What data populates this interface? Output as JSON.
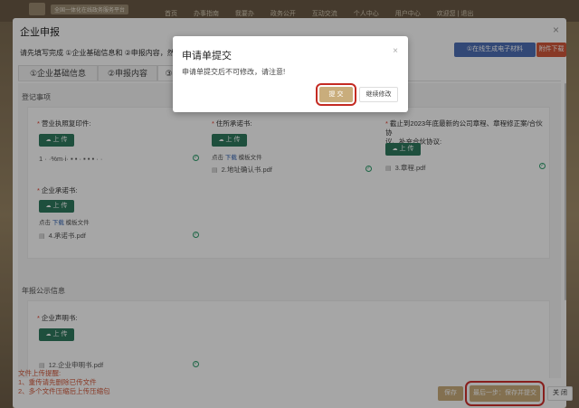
{
  "background": {
    "site_label": "全国一体化在线政务服务平台",
    "nav": [
      "首页",
      "办事指南",
      "我要办",
      "政务公开",
      "互动交流",
      "个人中心",
      "用户中心"
    ],
    "user": "欢迎您 | 退出"
  },
  "modal": {
    "title": "企业申报",
    "close_icon": "×",
    "instruction": "请先填写完成 ①企业基础信息和 ②申报内容，然后点",
    "online_button": "①在线生成电子材料",
    "attach_button": "附件下载",
    "tabs": [
      "①企业基础信息",
      "②申报内容",
      "③基"
    ]
  },
  "sections": {
    "registration_title": "登记事项",
    "annual_title": "年报公示信息"
  },
  "fields": {
    "license": {
      "label": "营业执照复印件:",
      "upload": "上 传",
      "file": "1 · ·%m·i·  ▪ ▪ ·  ▪ ▪ ▪ ·  ·"
    },
    "residence": {
      "label": "住所承诺书:",
      "upload": "上 传",
      "hint_prefix": "点击",
      "hint_link": "下载",
      "hint_suffix": "模板文件",
      "file": "2.地址确认书.pdf"
    },
    "charter": {
      "label_line1": "截止到2023年底最新的公司章程、章程修正案/合伙协",
      "label_line2": "议、补充合伙协议:",
      "upload": "上 传",
      "file": "3.章程.pdf"
    },
    "commitment": {
      "label": "企业承诺书:",
      "upload": "上 传",
      "hint_prefix": "点击",
      "hint_link": "下载",
      "hint_suffix": "模板文件",
      "file": "4.承诺书.pdf"
    },
    "declaration": {
      "label": "企业声明书:",
      "upload": "上 传",
      "file": "12.企业申明书.pdf"
    }
  },
  "notes": {
    "line1": "文件上传提醒:",
    "line2": "1、重传请先删除已传文件",
    "line3": "2、多个文件压缩后上传压缩包"
  },
  "footer": {
    "save": "保存",
    "submit": "最后一步：保存并提交",
    "close": "关 闭"
  },
  "dialog": {
    "title": "申请单提交",
    "close_icon": "×",
    "message": "申请单提交后不可修改，请注意!",
    "submit": "提 交",
    "continue": "继续修改"
  },
  "colors": {
    "upload_green": "#2f7a5e",
    "gold": "#c9ad7c",
    "highlight_red": "#d0312d",
    "blue": "#4e6fb5",
    "orange": "#d2583b"
  }
}
